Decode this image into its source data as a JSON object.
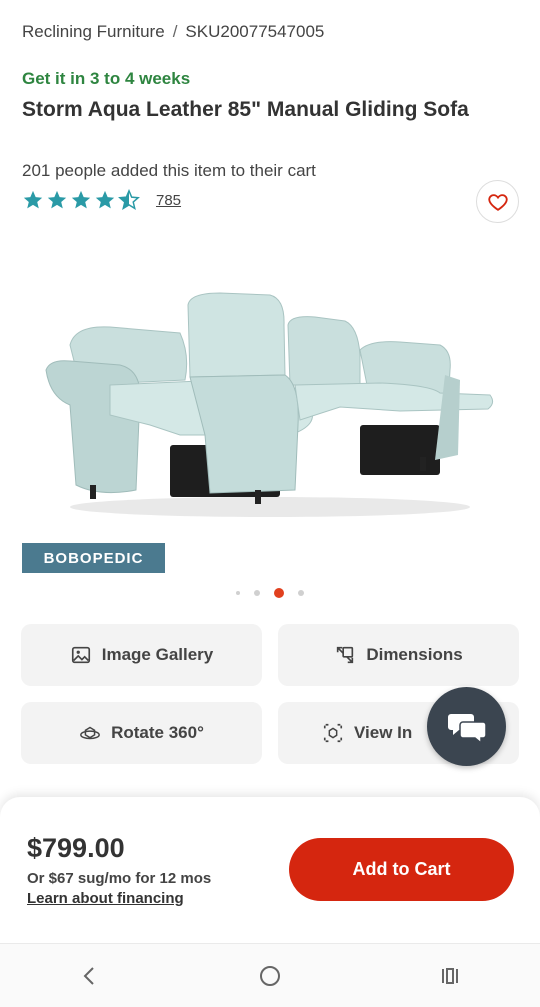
{
  "breadcrumb": {
    "category": "Reclining Furniture",
    "separator": "/",
    "sku": "SKU20077547005"
  },
  "product": {
    "delivery": "Get it in 3 to 4 weeks",
    "title": "Storm Aqua Leather 85\" Manual Gliding Sofa",
    "cart_note": "201 people added this item to their cart",
    "rating": 4.5,
    "review_count": "785",
    "brand": "BOBOPEDIC"
  },
  "gallery": {
    "slide_count": 4,
    "active_slide": 3
  },
  "actions": {
    "gallery_label": "Image Gallery",
    "dimensions_label": "Dimensions",
    "rotate_label": "Rotate 360°",
    "view_label": "View In"
  },
  "purchase": {
    "price": "$799.00",
    "monthly": "Or $67 sug/mo for 12 mos",
    "financing_link": "Learn about financing",
    "add_to_cart": "Add to Cart"
  },
  "colors": {
    "accent_red": "#d5260f",
    "delivery_green": "#2e8540",
    "star_teal": "#2a9aa6",
    "brand_blue": "#4b7a8f",
    "sofa_aqua": "#c9dfdd"
  },
  "icons": {
    "favorite": "heart-icon",
    "gallery": "image-icon",
    "dimensions": "dimensions-icon",
    "rotate": "rotate-360-icon",
    "view": "ar-view-icon",
    "chat": "chat-bubbles-icon",
    "back": "back-chevron-icon",
    "home": "home-circle-icon",
    "recents": "recent-apps-icon"
  }
}
